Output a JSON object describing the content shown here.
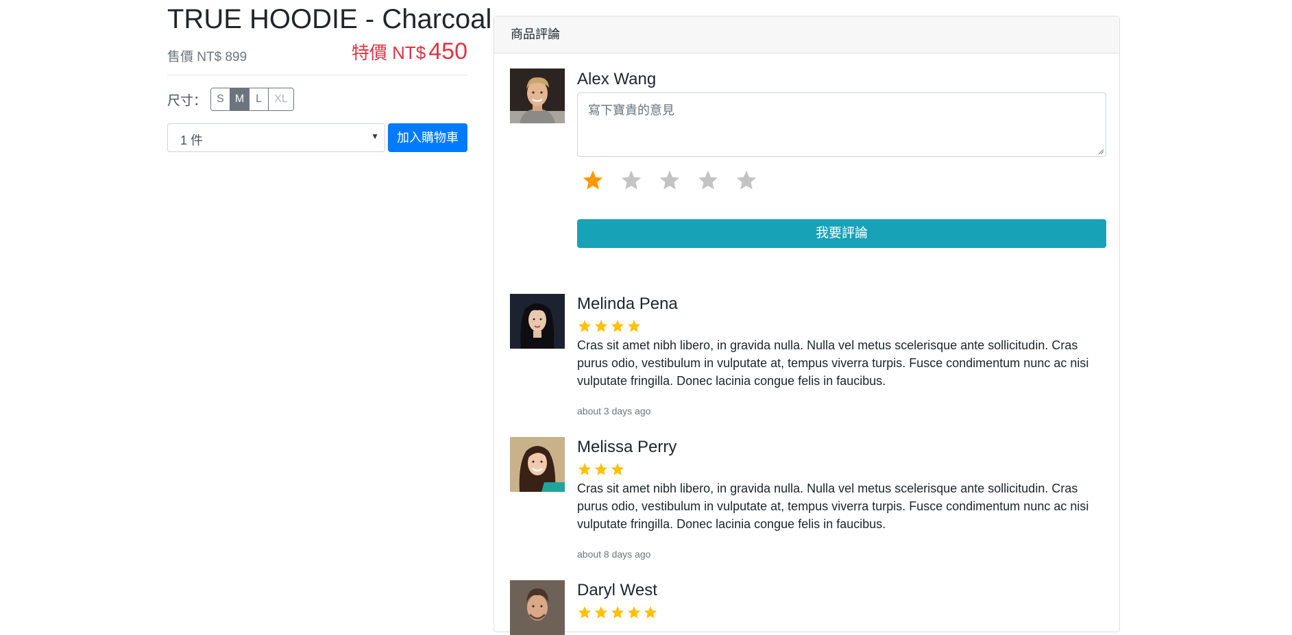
{
  "product": {
    "title": "TRUE HOODIE - Charcoal",
    "original_price": "售價 NT$ 899",
    "sale_label": "特價 NT$",
    "sale_value": "450",
    "size_label": "尺寸：",
    "sizes": [
      {
        "label": "S",
        "state": "normal"
      },
      {
        "label": "M",
        "state": "active"
      },
      {
        "label": "L",
        "state": "normal"
      },
      {
        "label": "XL",
        "state": "disabled"
      }
    ],
    "quantity_selected": "1 件",
    "add_to_cart_label": "加入購物車"
  },
  "reviews_card": {
    "header": "商品評論",
    "compose": {
      "user_name": "Alex Wang",
      "placeholder": "寫下寶貴的意見",
      "rating_selected": 1,
      "rating_max": 5,
      "submit_label": "我要評論"
    },
    "reviews": [
      {
        "name": "Melinda Pena",
        "stars": 4,
        "text": "Cras sit amet nibh libero, in gravida nulla. Nulla vel metus scelerisque ante sollicitudin. Cras purus odio, vestibulum in vulputate at, tempus viverra turpis. Fusce condimentum nunc ac nisi vulputate fringilla. Donec lacinia congue felis in faucibus.",
        "time": "about 3 days ago"
      },
      {
        "name": "Melissa Perry",
        "stars": 3,
        "text": "Cras sit amet nibh libero, in gravida nulla. Nulla vel metus scelerisque ante sollicitudin. Cras purus odio, vestibulum in vulputate at, tempus viverra turpis. Fusce condimentum nunc ac nisi vulputate fringilla. Donec lacinia congue felis in faucibus.",
        "time": "about 8 days ago"
      },
      {
        "name": "Daryl West",
        "stars": 5,
        "text": "",
        "time": ""
      }
    ]
  },
  "colors": {
    "sale_red": "#dc3545",
    "primary_blue": "#007bff",
    "info_teal": "#17a2b8",
    "star_gold": "#ffc107",
    "star_orange": "#ff9800",
    "star_gray": "#c4c4c4"
  }
}
